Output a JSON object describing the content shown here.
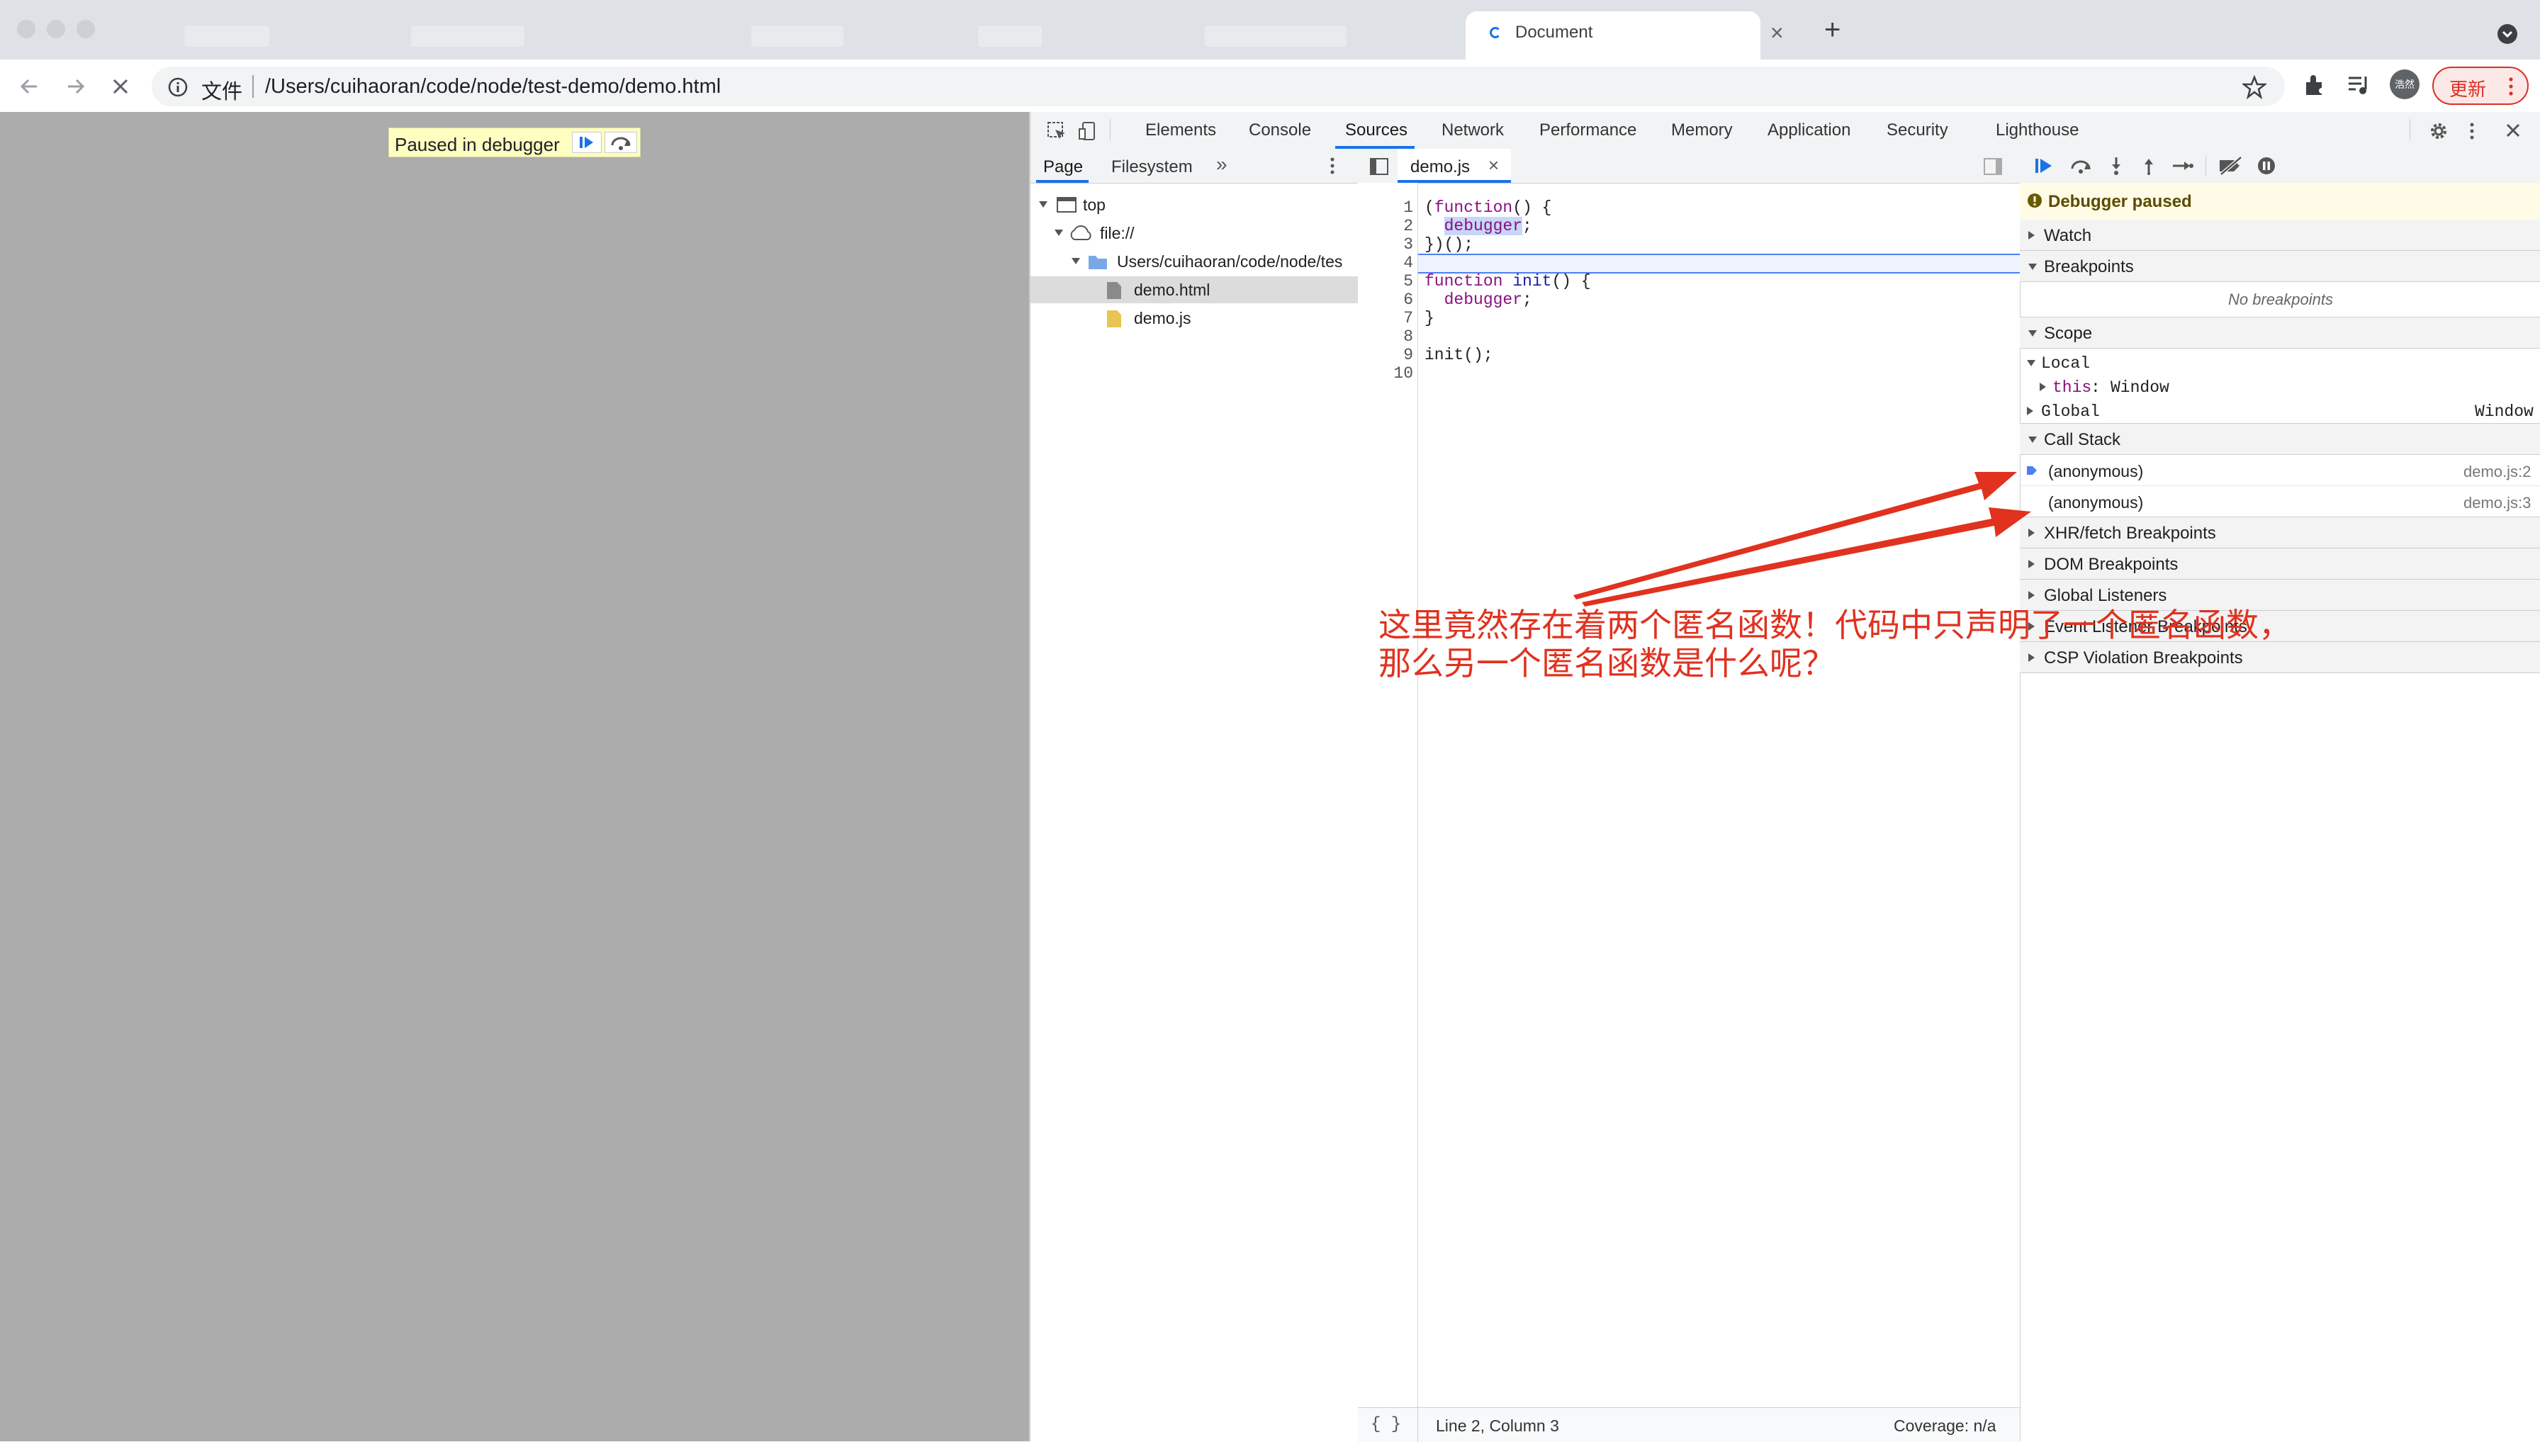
{
  "browser": {
    "tab_title": "Document",
    "url_scheme_label": "文件",
    "url": "/Users/cuihaoran/code/node/test-demo/demo.html",
    "update_label": "更新",
    "avatar_text": "浩然"
  },
  "page": {
    "paused_banner": "Paused in debugger"
  },
  "devtools": {
    "tabs": [
      "Elements",
      "Console",
      "Sources",
      "Network",
      "Performance",
      "Memory",
      "Application",
      "Security",
      "Lighthouse"
    ],
    "active_tab": "Sources",
    "navigator": {
      "tabs": [
        "Page",
        "Filesystem"
      ],
      "tree": [
        "top",
        "file://",
        "Users/cuihaoran/code/node/tes",
        "demo.html",
        "demo.js"
      ],
      "selected": "demo.html"
    },
    "editor": {
      "file_tab": "demo.js",
      "line_numbers": [
        "1",
        "2",
        "3",
        "4",
        "5",
        "6",
        "7",
        "8",
        "9",
        "10"
      ],
      "status_position": "Line 2, Column 3",
      "status_coverage": "Coverage: n/a"
    },
    "debugger": {
      "paused_message": "Debugger paused",
      "sections": {
        "watch": "Watch",
        "breakpoints": "Breakpoints",
        "no_breakpoints": "No breakpoints",
        "scope": "Scope",
        "call_stack": "Call Stack",
        "xhr": "XHR/fetch Breakpoints",
        "dom": "DOM Breakpoints",
        "global_listeners": "Global Listeners",
        "event_listener": "Event Listener Breakpoints",
        "csp": "CSP Violation Breakpoints"
      },
      "scope": {
        "local": "Local",
        "this_key": "this",
        "this_value": "Window",
        "global": "Global",
        "global_value": "Window"
      },
      "call_stack": [
        {
          "name": "(anonymous)",
          "location": "demo.js:2"
        },
        {
          "name": "(anonymous)",
          "location": "demo.js:3"
        }
      ]
    }
  },
  "annotation": {
    "line1": "这里竟然存在着两个匿名函数！代码中只声明了一个匿名函数，",
    "line2": "那么另一个匿名函数是什么呢？",
    "color": "#e0321f"
  }
}
